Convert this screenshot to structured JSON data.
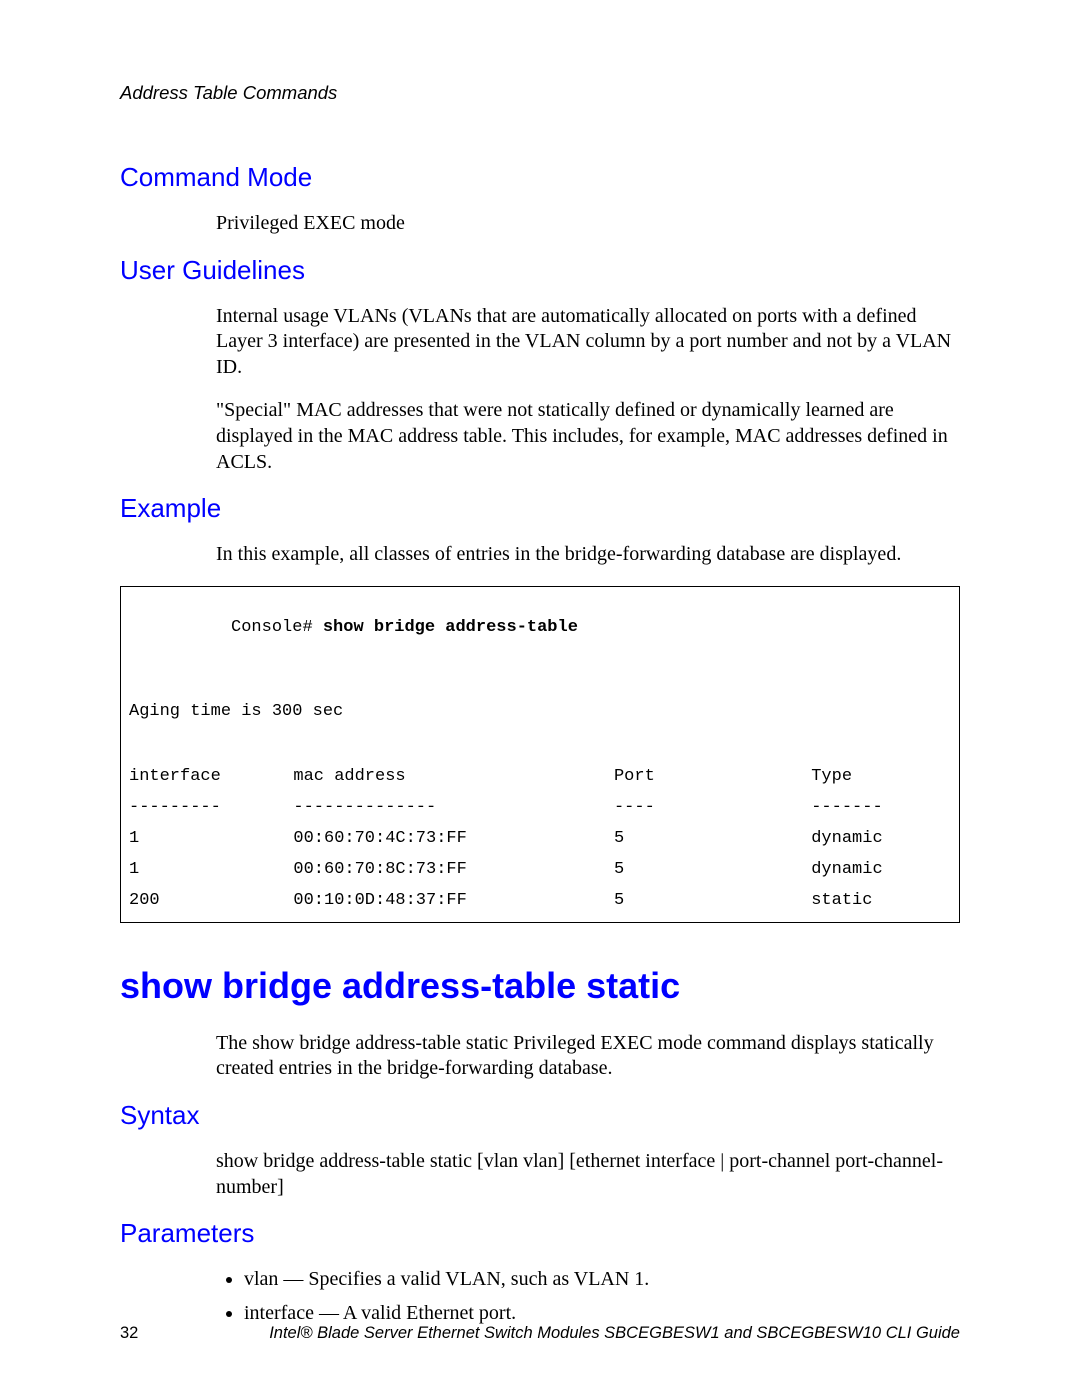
{
  "running_head": "Address Table Commands",
  "sections": {
    "command_mode": {
      "heading": "Command Mode",
      "text": "Privileged EXEC mode"
    },
    "user_guidelines": {
      "heading": "User Guidelines",
      "para1": "Internal usage VLANs (VLANs that are automatically allocated on ports with a defined Layer 3 interface) are presented in the VLAN column by a port number and not by a VLAN ID.",
      "para2": "\"Special\" MAC addresses that were not statically defined or dynamically learned are displayed in the MAC address table. This includes, for example, MAC addresses defined in ACLS."
    },
    "example": {
      "heading": "Example",
      "intro": "In this example, all classes of entries in the bridge-forwarding database are displayed.",
      "prompt": "Console# ",
      "command": "show bridge address-table",
      "aging_line": "Aging time is 300 sec",
      "columns": {
        "interface": "interface",
        "mac": "mac address",
        "port": "Port",
        "type": "Type"
      },
      "dividers": {
        "interface": "---------",
        "mac": "--------------",
        "port": "----",
        "type": "-------"
      },
      "rows": [
        {
          "interface": "1",
          "mac": "00:60:70:4C:73:FF",
          "port": "5",
          "type": "dynamic"
        },
        {
          "interface": "1",
          "mac": "00:60:70:8C:73:FF",
          "port": "5",
          "type": "dynamic"
        },
        {
          "interface": "200",
          "mac": "00:10:0D:48:37:FF",
          "port": "5",
          "type": "static"
        }
      ]
    },
    "title": "show bridge address-table static",
    "title_desc": "The show bridge address-table static Privileged EXEC mode command displays statically created entries in the bridge-forwarding database.",
    "syntax": {
      "heading": "Syntax",
      "text": "show bridge address-table static [vlan vlan] [ethernet interface | port-channel port-channel-number]"
    },
    "parameters": {
      "heading": "Parameters",
      "items": [
        "vlan — Specifies a valid VLAN, such as VLAN 1.",
        "interface — A valid Ethernet port."
      ]
    }
  },
  "footer": {
    "page_number": "32",
    "doc_title": "Intel® Blade Server Ethernet Switch Modules SBCEGBESW1 and SBCEGBESW10 CLI Guide"
  }
}
